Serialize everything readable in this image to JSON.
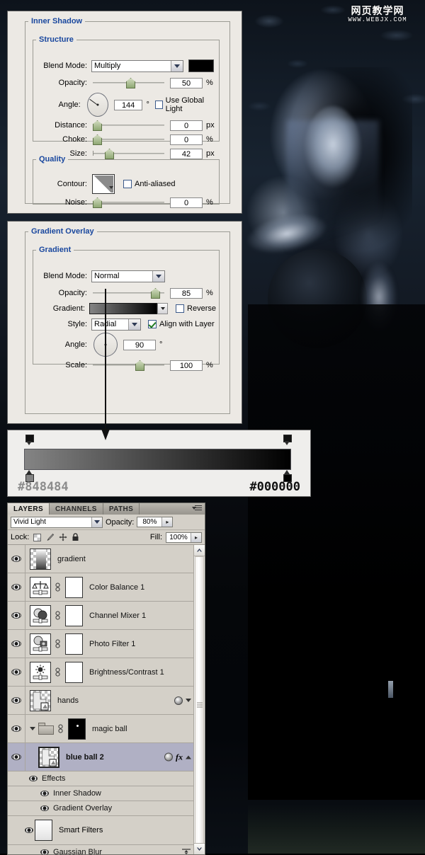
{
  "watermark": {
    "cn": "网页教学网",
    "url": "WWW.WEBJX.COM"
  },
  "inner_shadow": {
    "title": "Inner Shadow",
    "structure": {
      "title": "Structure",
      "blend_mode_label": "Blend Mode:",
      "blend_mode_value": "Multiply",
      "blend_color": "#000000",
      "opacity_label": "Opacity:",
      "opacity_value": "50",
      "opacity_unit": "%",
      "angle_label": "Angle:",
      "angle_value": "144",
      "angle_unit": "°",
      "use_global_light_label": "Use Global Light",
      "use_global_light_checked": false,
      "distance_label": "Distance:",
      "distance_value": "0",
      "distance_unit": "px",
      "choke_label": "Choke:",
      "choke_value": "0",
      "choke_unit": "%",
      "size_label": "Size:",
      "size_value": "42",
      "size_unit": "px"
    },
    "quality": {
      "title": "Quality",
      "contour_label": "Contour:",
      "anti_aliased_label": "Anti-aliased",
      "anti_aliased_checked": false,
      "noise_label": "Noise:",
      "noise_value": "0",
      "noise_unit": "%"
    }
  },
  "gradient_overlay": {
    "title": "Gradient Overlay",
    "gradient_group_title": "Gradient",
    "blend_mode_label": "Blend Mode:",
    "blend_mode_value": "Normal",
    "opacity_label": "Opacity:",
    "opacity_value": "85",
    "opacity_unit": "%",
    "gradient_label": "Gradient:",
    "reverse_label": "Reverse",
    "reverse_checked": false,
    "style_label": "Style:",
    "style_value": "Radial",
    "align_with_layer_label": "Align with Layer",
    "align_with_layer_checked": true,
    "angle_label": "Angle:",
    "angle_value": "90",
    "angle_unit": "°",
    "scale_label": "Scale:",
    "scale_value": "100",
    "scale_unit": "%"
  },
  "gradient_editor": {
    "left_color": "#848484",
    "right_color": "#000000",
    "left_label": "#848484",
    "right_label": "#000000"
  },
  "layers_panel": {
    "tabs": [
      {
        "label": "LAYERS",
        "active": true
      },
      {
        "label": "CHANNELS",
        "active": false
      },
      {
        "label": "PATHS",
        "active": false
      }
    ],
    "blend_mode": "Vivid Light",
    "opacity_label": "Opacity:",
    "opacity_value": "80%",
    "lock_label": "Lock:",
    "fill_label": "Fill:",
    "fill_value": "100%",
    "rows": [
      {
        "name": "gradient",
        "type": "layer",
        "kind": "gradient-thumb",
        "selected": false
      },
      {
        "name": "Color Balance 1",
        "type": "adjustment",
        "kind": "color-balance",
        "selected": false
      },
      {
        "name": "Channel Mixer 1",
        "type": "adjustment",
        "kind": "channel-mixer",
        "selected": false
      },
      {
        "name": "Photo Filter 1",
        "type": "adjustment",
        "kind": "photo-filter",
        "selected": false
      },
      {
        "name": "Brightness/Contrast 1",
        "type": "adjustment",
        "kind": "brightness-contrast",
        "selected": false
      },
      {
        "name": "hands",
        "type": "smart-object",
        "kind": "smart",
        "selected": false
      },
      {
        "name": "magic ball",
        "type": "group",
        "kind": "folder",
        "selected": false
      },
      {
        "name": "blue ball 2",
        "type": "smart-object",
        "kind": "smart",
        "selected": true
      }
    ],
    "effects": {
      "header": "Effects",
      "items": [
        "Inner Shadow",
        "Gradient Overlay"
      ]
    },
    "smart_filters": {
      "header": "Smart Filters",
      "items": [
        "Gaussian Blur"
      ]
    }
  }
}
